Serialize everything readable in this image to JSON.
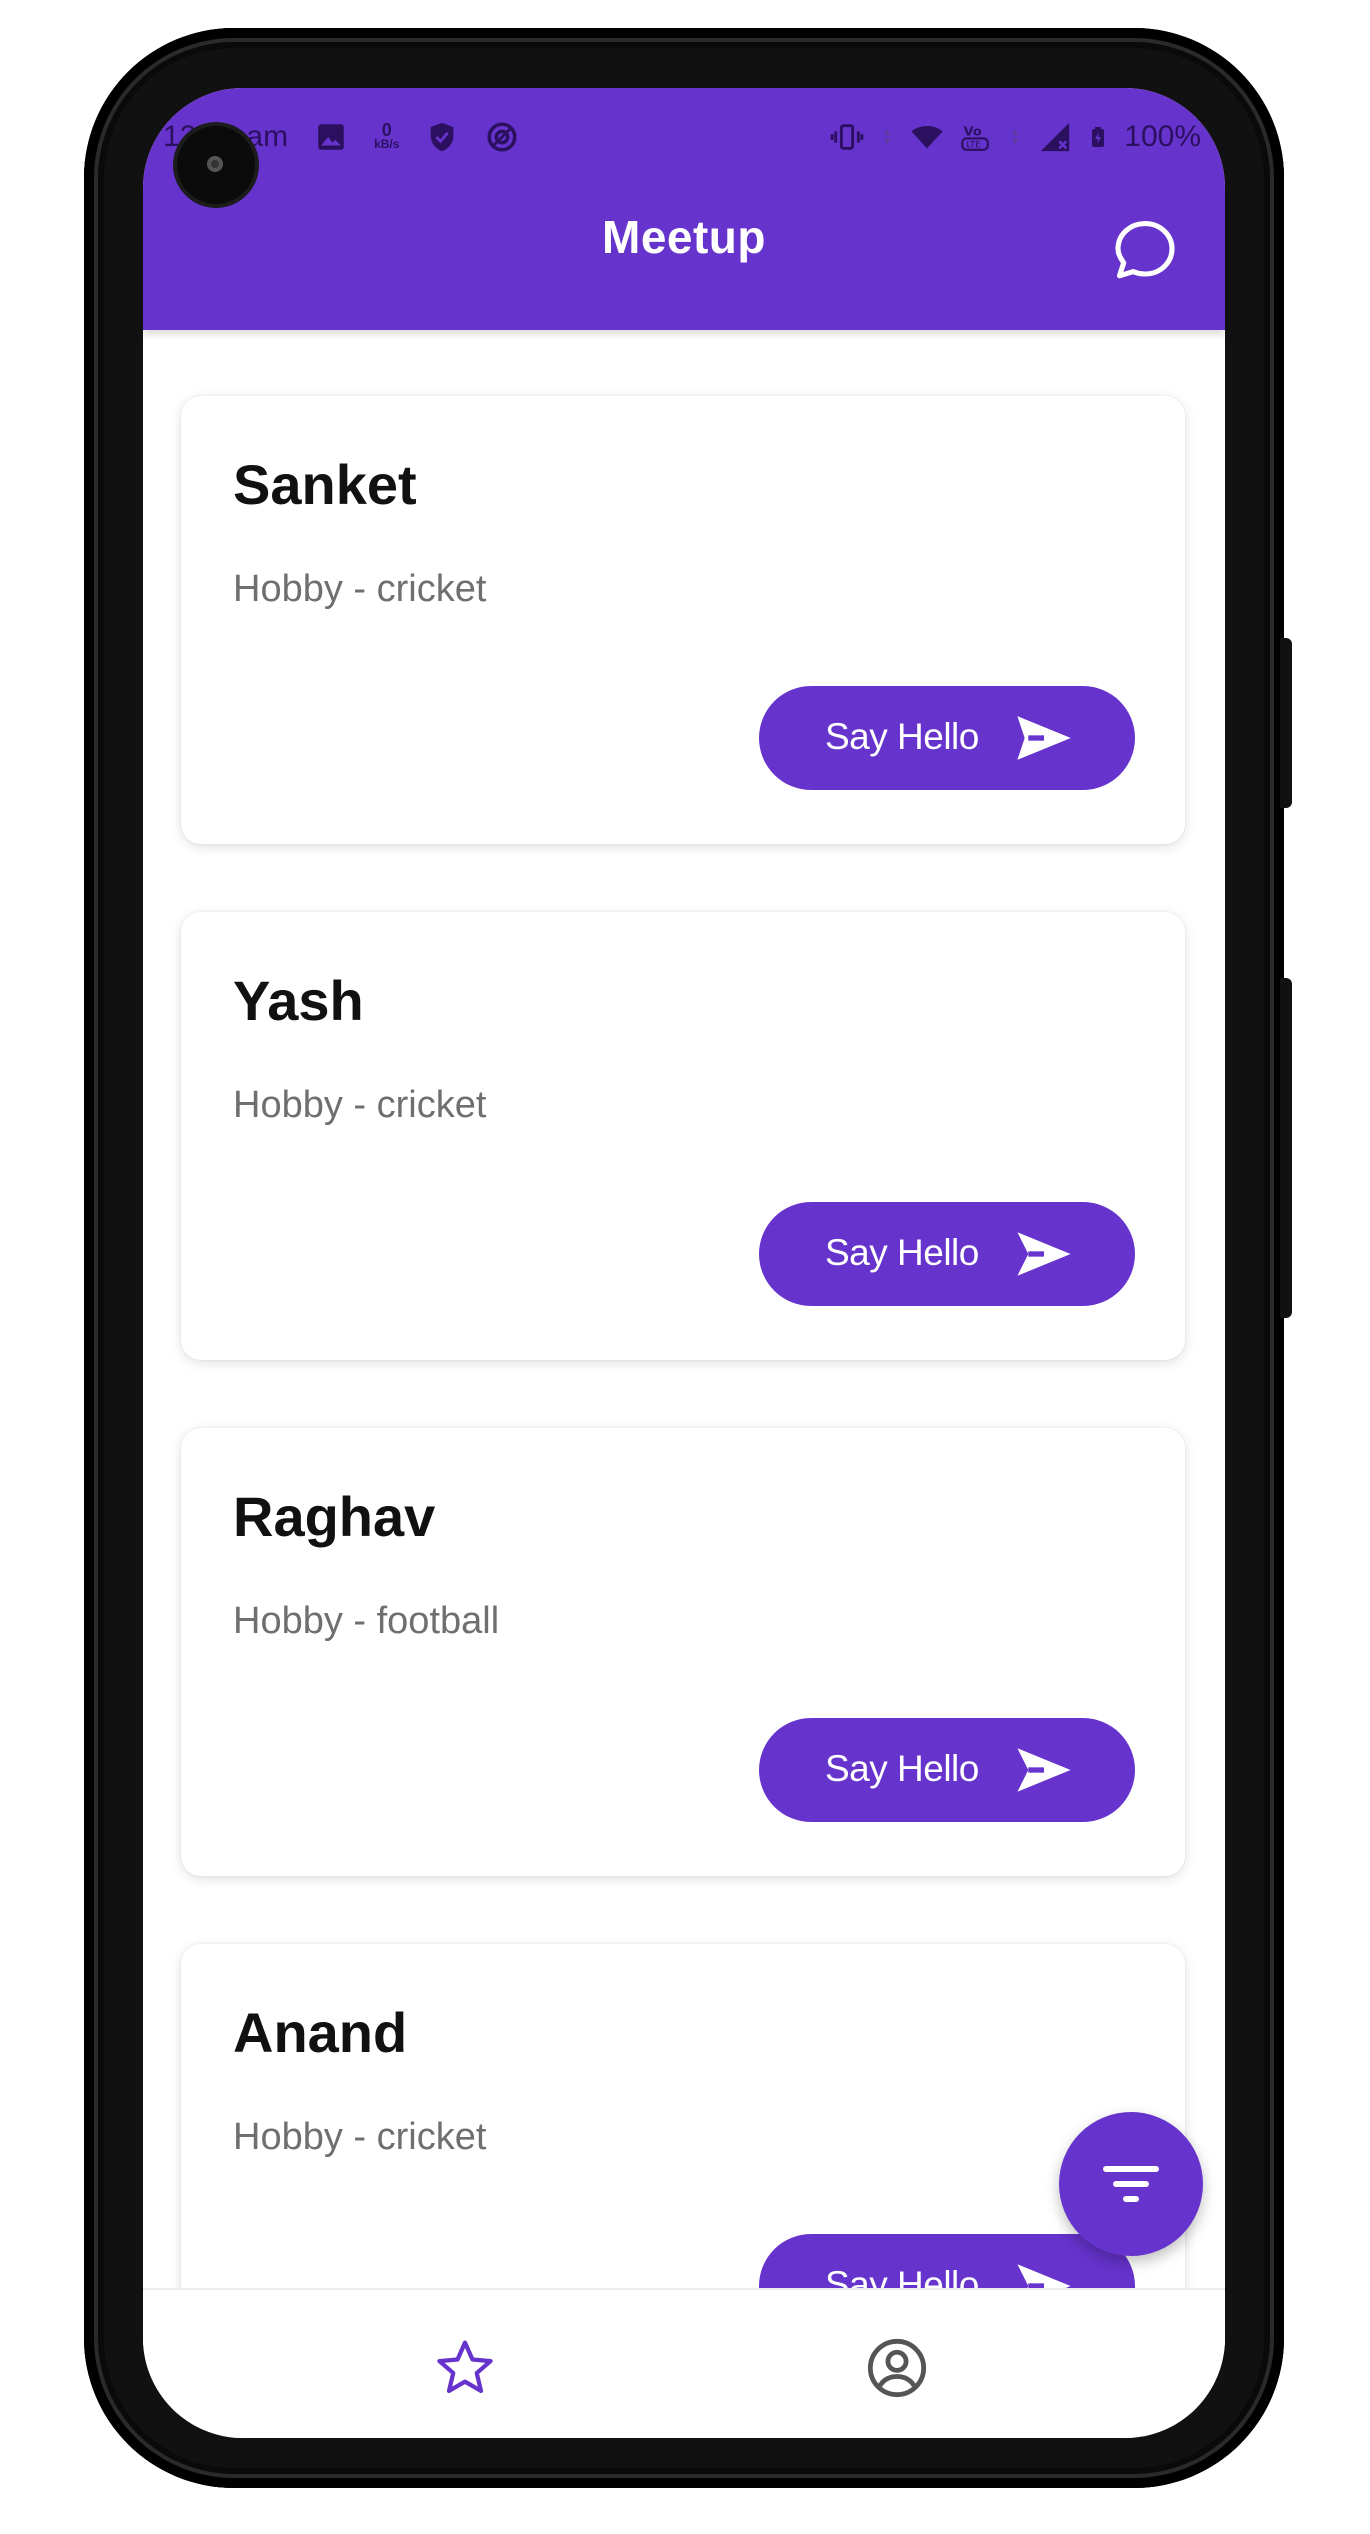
{
  "status_bar": {
    "time": "12:24 am",
    "network_speed_value": "0",
    "network_speed_unit": "kB/s",
    "battery": "100%",
    "icons": [
      "gallery-icon",
      "shield-icon",
      "vpn-icon",
      "vibrate-icon",
      "wifi-icon",
      "volte-icon",
      "signal-icon",
      "battery-icon"
    ]
  },
  "app_bar": {
    "title": "Meetup",
    "chat_icon": "chat-bubble-icon"
  },
  "users": [
    {
      "name": "Sanket",
      "hobby": "Hobby - cricket",
      "button_label": "Say Hello"
    },
    {
      "name": "Yash",
      "hobby": "Hobby - cricket",
      "button_label": "Say Hello"
    },
    {
      "name": "Raghav",
      "hobby": "Hobby - football",
      "button_label": "Say Hello"
    },
    {
      "name": "Anand",
      "hobby": "Hobby - cricket",
      "button_label": "Say Hello"
    }
  ],
  "fab": {
    "icon": "filter-icon"
  },
  "bottom_nav": {
    "items": [
      {
        "icon": "star-icon",
        "active": true
      },
      {
        "icon": "account-icon",
        "active": false
      }
    ]
  },
  "colors": {
    "primary": "#6633CC",
    "background": "#FFFFFF",
    "hobby_text": "#6F6F6F",
    "inactive_icon": "#555555"
  }
}
